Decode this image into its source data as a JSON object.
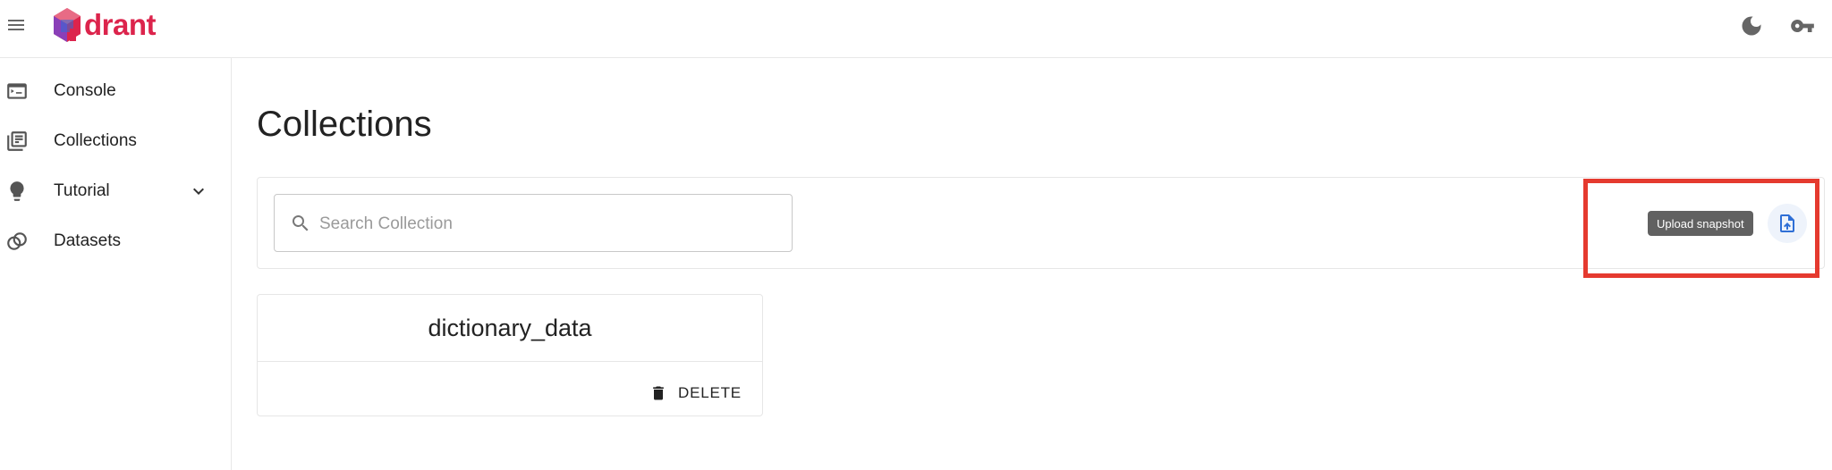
{
  "app": {
    "logo_text": "drant"
  },
  "sidebar": {
    "items": [
      {
        "label": "Console"
      },
      {
        "label": "Collections"
      },
      {
        "label": "Tutorial"
      },
      {
        "label": "Datasets"
      }
    ]
  },
  "main": {
    "title": "Collections",
    "search": {
      "placeholder": "Search Collection",
      "value": ""
    },
    "upload_tooltip": "Upload snapshot",
    "collections": [
      {
        "name": "dictionary_data",
        "delete_label": "DELETE"
      }
    ]
  },
  "colors": {
    "brand": "#dc244c",
    "logo_blue": "#2f6bd8",
    "highlight": "#e53a2f",
    "upload_icon": "#2f6fd6"
  },
  "icons": [
    "menu-icon",
    "qdrant-logo-icon",
    "dark-mode-icon",
    "key-icon",
    "console-icon",
    "collections-icon",
    "lightbulb-icon",
    "chevron-down-icon",
    "datasets-icon",
    "search-icon",
    "upload-file-icon",
    "trash-icon"
  ]
}
